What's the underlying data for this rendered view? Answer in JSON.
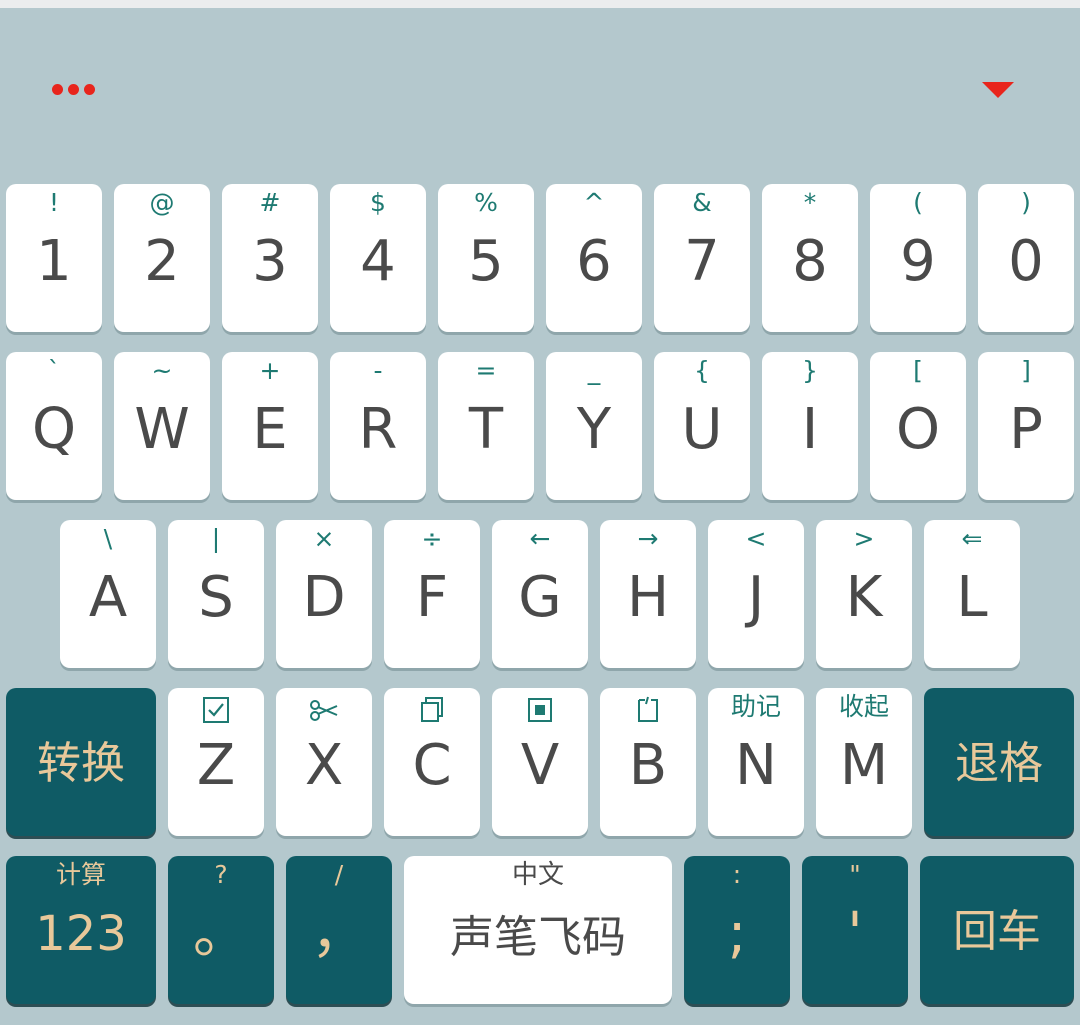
{
  "toolbar": {
    "menu_icon": "more-dots-icon",
    "collapse_icon": "collapse-keyboard-icon",
    "accent_color": "#e8251c"
  },
  "colors": {
    "background": "#b4c8cd",
    "key": "#ffffff",
    "function_key": "#0f5b65",
    "secondary_label": "#1e7a72",
    "function_label": "#e8c89a",
    "main_label": "#4a4a4a"
  },
  "keys": {
    "row1": [
      {
        "sec": "!",
        "main": "1"
      },
      {
        "sec": "@",
        "main": "2"
      },
      {
        "sec": "#",
        "main": "3"
      },
      {
        "sec": "$",
        "main": "4"
      },
      {
        "sec": "%",
        "main": "5"
      },
      {
        "sec": "^",
        "main": "6"
      },
      {
        "sec": "&",
        "main": "7"
      },
      {
        "sec": "*",
        "main": "8"
      },
      {
        "sec": "(",
        "main": "9"
      },
      {
        "sec": ")",
        "main": "0"
      }
    ],
    "row2": [
      {
        "sec": "`",
        "main": "Q"
      },
      {
        "sec": "~",
        "main": "W"
      },
      {
        "sec": "+",
        "main": "E"
      },
      {
        "sec": "-",
        "main": "R"
      },
      {
        "sec": "=",
        "main": "T"
      },
      {
        "sec": "_",
        "main": "Y"
      },
      {
        "sec": "{",
        "main": "U"
      },
      {
        "sec": "}",
        "main": "I"
      },
      {
        "sec": "[",
        "main": "O"
      },
      {
        "sec": "]",
        "main": "P"
      }
    ],
    "row3": [
      {
        "sec": "\\",
        "main": "A"
      },
      {
        "sec": "|",
        "main": "S"
      },
      {
        "sec": "×",
        "main": "D"
      },
      {
        "sec": "÷",
        "main": "F"
      },
      {
        "sec": "←",
        "main": "G"
      },
      {
        "sec": "→",
        "main": "H"
      },
      {
        "sec": "<",
        "main": "J"
      },
      {
        "sec": ">",
        "main": "K"
      },
      {
        "sec": "⇐",
        "main": "L"
      }
    ],
    "row4": {
      "switch": "转换",
      "backspace": "退格",
      "letters": [
        {
          "icon": "select-all-icon",
          "main": "Z"
        },
        {
          "icon": "cut-icon",
          "main": "X"
        },
        {
          "icon": "copy-icon",
          "main": "C"
        },
        {
          "icon": "paste-icon",
          "main": "V"
        },
        {
          "icon": "clipboard-icon",
          "main": "B"
        },
        {
          "sec": "助记",
          "main": "N"
        },
        {
          "sec": "收起",
          "main": "M"
        }
      ]
    },
    "row5": {
      "num": {
        "sec": "计算",
        "main": "123"
      },
      "period": {
        "sec": "?",
        "main": "。"
      },
      "comma": {
        "sec": "/",
        "main": "，"
      },
      "space": {
        "sec": "中文",
        "main": "声笔飞码"
      },
      "semicolon": {
        "sec": ":",
        "main": ";"
      },
      "quote": {
        "sec": "\"",
        "main": "'"
      },
      "enter": "回车"
    }
  }
}
